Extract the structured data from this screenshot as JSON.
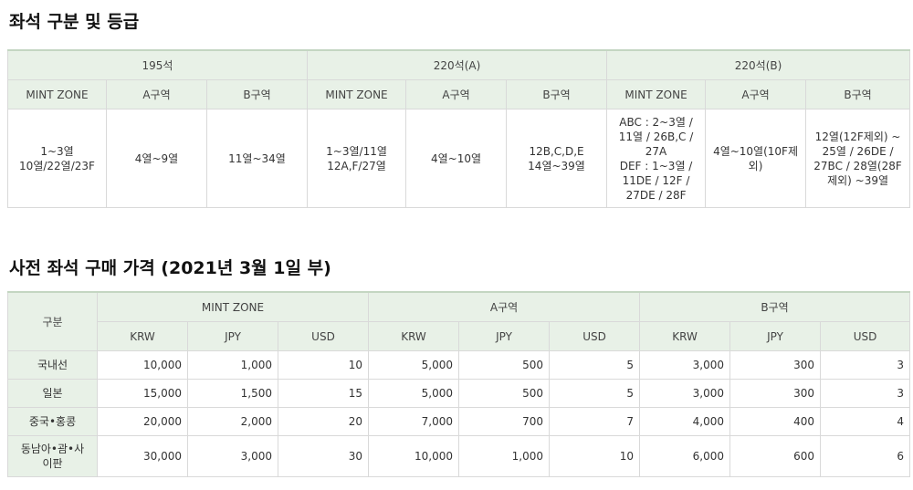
{
  "section1": {
    "title": "좌석 구분 및 등급",
    "groups": [
      "195석",
      "220석(A)",
      "220석(B)"
    ],
    "subheaders": [
      "MINT ZONE",
      "A구역",
      "B구역"
    ],
    "cells": [
      {
        "lines": [
          "1~3열",
          "10열/22열/23F"
        ]
      },
      {
        "lines": [
          "4열~9열"
        ]
      },
      {
        "lines": [
          "11열~34열"
        ]
      },
      {
        "lines": [
          "1~3열/11열",
          "12A,F/27열"
        ]
      },
      {
        "lines": [
          "4열~10열"
        ]
      },
      {
        "lines": [
          "12B,C,D,E",
          "14열~39열"
        ]
      },
      {
        "lines": [
          "ABC : 2~3열 /",
          "11열 / 26B,C /",
          "27A",
          "DEF : 1~3열 /",
          "11DE / 12F /",
          "27DE / 28F"
        ]
      },
      {
        "lines": [
          "4열~10열(10F제",
          "외)"
        ]
      },
      {
        "lines": [
          "12열(12F제외) ~",
          "25열 / 26DE /",
          "27BC / 28열(28F",
          "제외) ~39열"
        ]
      }
    ]
  },
  "section2": {
    "title": "사전 좌석 구매 가격 (2021년 3월 1일 부)",
    "category_header": "구분",
    "groups": [
      "MINT ZONE",
      "A구역",
      "B구역"
    ],
    "currencies": [
      "KRW",
      "JPY",
      "USD"
    ],
    "rows": [
      {
        "label": "국내선",
        "label_lines": [
          "국내선"
        ],
        "values": [
          "10,000",
          "1,000",
          "10",
          "5,000",
          "500",
          "5",
          "3,000",
          "300",
          "3"
        ]
      },
      {
        "label": "일본",
        "label_lines": [
          "일본"
        ],
        "values": [
          "15,000",
          "1,500",
          "15",
          "5,000",
          "500",
          "5",
          "3,000",
          "300",
          "3"
        ]
      },
      {
        "label": "중국•홍콩",
        "label_lines": [
          "중국•홍콩"
        ],
        "values": [
          "20,000",
          "2,000",
          "20",
          "7,000",
          "700",
          "7",
          "4,000",
          "400",
          "4"
        ]
      },
      {
        "label": "동남아•괌•사이판",
        "label_lines": [
          "동남아•괌•사",
          "이판"
        ],
        "values": [
          "30,000",
          "3,000",
          "30",
          "10,000",
          "1,000",
          "10",
          "6,000",
          "600",
          "6"
        ]
      }
    ]
  }
}
